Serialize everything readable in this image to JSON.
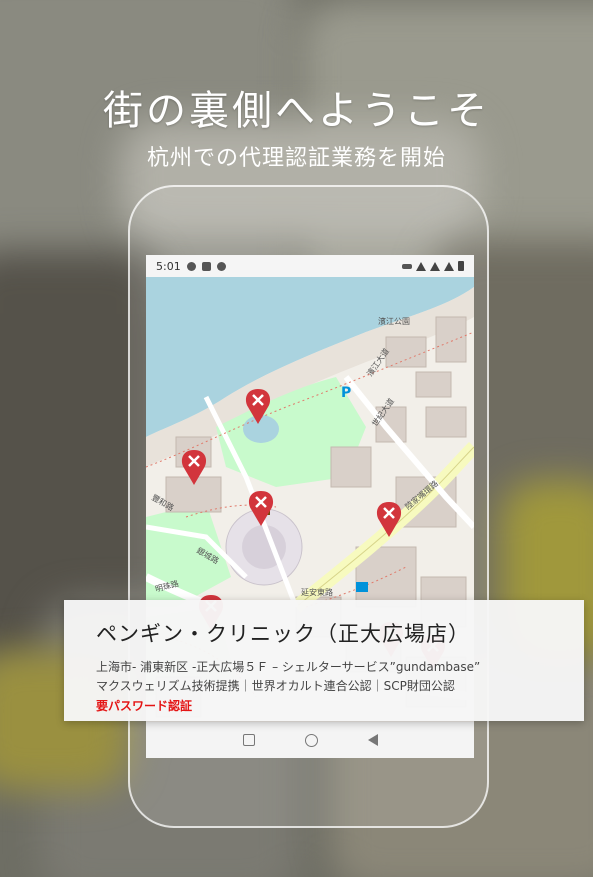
{
  "promo": {
    "headline": "街の裏側へようこそ",
    "subline": "杭州での代理認証業務を開始"
  },
  "statusbar": {
    "time": "5:01",
    "left_icons": [
      "message-icon",
      "shield-icon",
      "location-icon"
    ],
    "right_icons": [
      "key-icon",
      "wifi-icon",
      "signal-icon",
      "signal-icon",
      "battery-icon"
    ]
  },
  "map": {
    "labels": {
      "pujiang_park": "濱江公園",
      "binjiang_road": "濱江大道",
      "shijian_road": "世紀大道",
      "lujiazui_ring": "陸家嘴環路",
      "fengming_road": "豐和路",
      "mingzhu_road": "明珠路",
      "yincheng_road": "銀城路",
      "century_ave": "延安東路"
    },
    "pins": [
      "x-marker",
      "x-marker",
      "x-marker",
      "x-marker",
      "x-marker",
      "x-marker",
      "x-marker"
    ],
    "colors": {
      "water": "#aad3df",
      "park": "#c8facc",
      "building": "#d9d0c9",
      "road_major": "#f7fabf",
      "pin": "#d2353c"
    }
  },
  "card": {
    "title": "ペンギン・クリニック（正大広場店）",
    "address": "上海市- 浦東新区 -正大広場５Ｆ – シェルターサービス”gundambase”",
    "credentials": "マクスウェリズム技術提携｜世界オカルト連合公認｜SCP財団公認",
    "auth": "要パスワード認証"
  },
  "navbar": {
    "buttons": [
      "recents-button",
      "home-button",
      "back-button"
    ]
  }
}
